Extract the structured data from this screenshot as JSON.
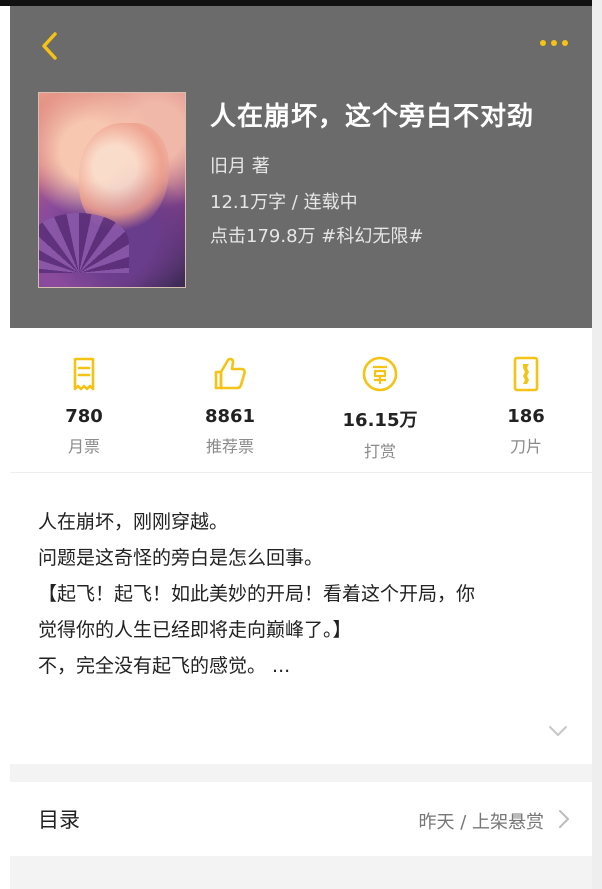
{
  "colors": {
    "accent": "#f5c313",
    "header_bg": "#6b6b6b"
  },
  "nav": {
    "back_icon": "chevron-left-icon",
    "more_icon": "more-dots-icon"
  },
  "book": {
    "title": "人在崩坏，这个旁白不对劲",
    "author": "旧月  著",
    "words_status": "12.1万字 / 连载中",
    "clicks_tags": "点击179.8万  #科幻无限#"
  },
  "stats": [
    {
      "icon": "monthly-ticket-icon",
      "value": "780",
      "label": "月票"
    },
    {
      "icon": "thumbs-up-icon",
      "value": "8861",
      "label": "推荐票"
    },
    {
      "icon": "reward-coin-icon",
      "value": "16.15万",
      "label": "打赏"
    },
    {
      "icon": "blade-icon",
      "value": "186",
      "label": "刀片"
    }
  ],
  "description": {
    "lines": [
      "人在崩坏，刚刚穿越。",
      "问题是这奇怪的旁白是怎么回事。",
      "【起飞！起飞！如此美妙的开局！看着这个开局，你",
      "觉得你的人生已经即将走向巅峰了。】",
      "不，完全没有起飞的感觉。 ..."
    ],
    "expand_icon": "chevron-down-icon"
  },
  "toc": {
    "title": "目录",
    "status": "昨天 / 上架悬赏"
  }
}
